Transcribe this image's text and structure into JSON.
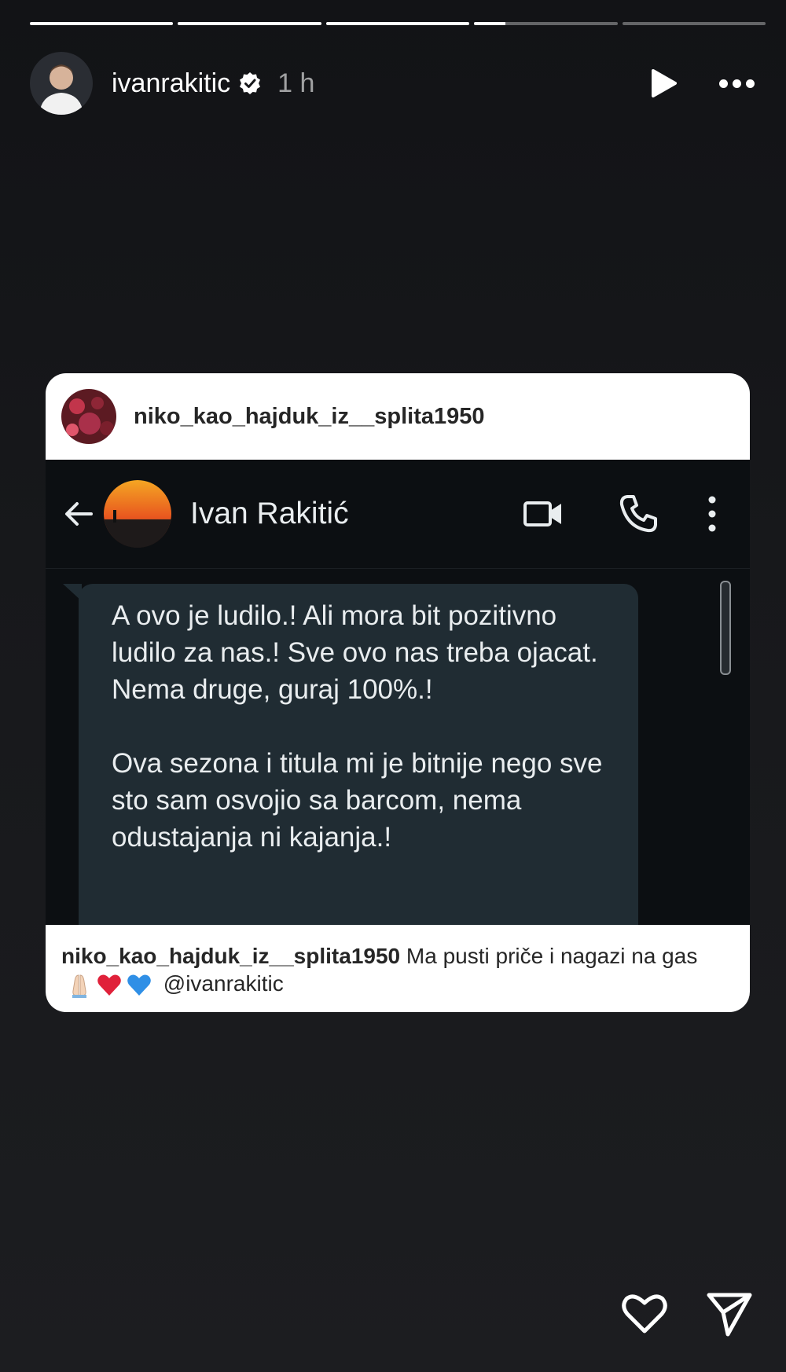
{
  "story": {
    "progress": [
      1,
      1,
      1,
      0.22,
      0
    ],
    "username": "ivanrakitic",
    "time_ago": "1 h"
  },
  "shared_post": {
    "author": "niko_kao_hajduk_iz__splita1950",
    "screenshot": {
      "contact_name": "Ivan Rakitić",
      "message": "A ovo je ludilo.! Ali mora bit pozitivno ludilo za nas.! Sve ovo nas treba ojacat.\nNema druge, guraj 100%.!\n\nOva sezona i titula mi je bitnije nego sve sto sam osvojio sa barcom, nema odustajanja ni kajanja.!"
    },
    "caption_user": "niko_kao_hajduk_iz__splita1950",
    "caption_text": "Ma pusti priče i nagazi na gas",
    "caption_mention": "@ivanrakitic",
    "caption_emojis": [
      "folded-hands",
      "red-heart",
      "blue-heart"
    ]
  },
  "colors": {
    "background": "#17181b",
    "chat_background": "#0c0f12",
    "bubble": "#202c33",
    "card": "#ffffff"
  }
}
